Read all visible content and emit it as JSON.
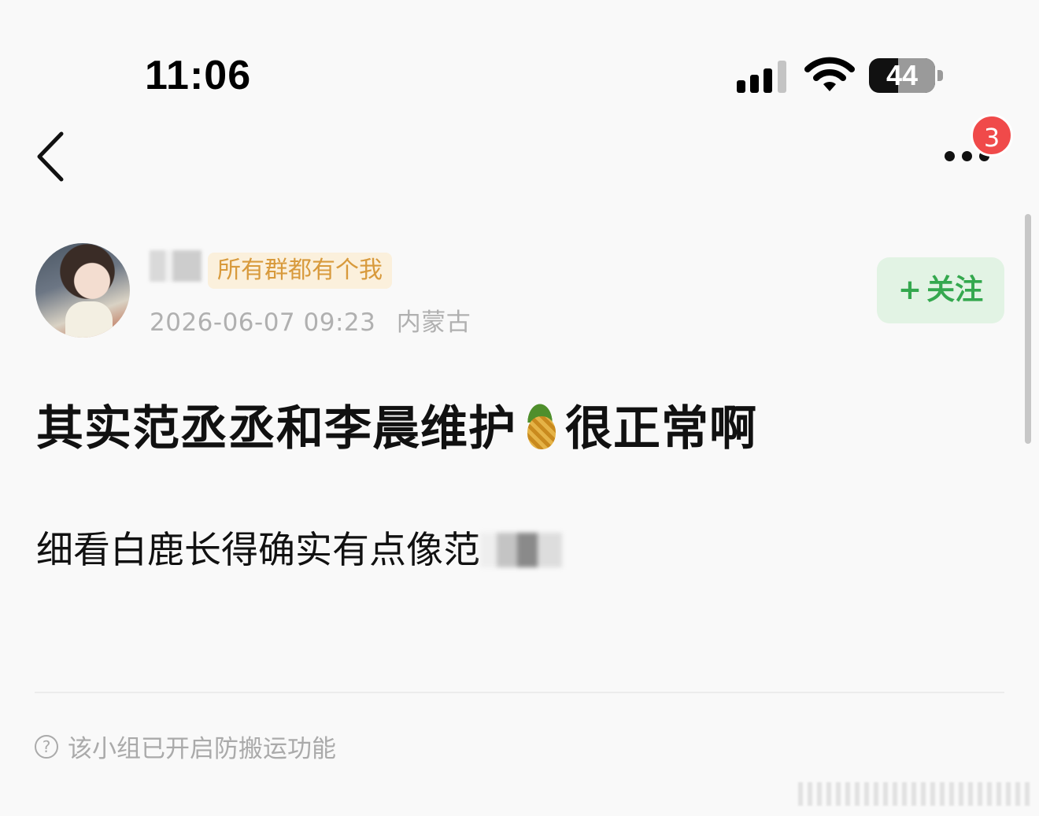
{
  "status_bar": {
    "time": "11:06",
    "battery": "44"
  },
  "nav": {
    "badge_count": "3"
  },
  "post": {
    "group_tag": "所有群都有个我",
    "timestamp": "2026-06-07 09:23",
    "location": "内蒙古",
    "follow_plus": "+",
    "follow_label": "关注",
    "title_before": "其实范丞丞和李晨维护",
    "title_after": "很正常啊",
    "body_text": "细看白鹿长得确实有点像范"
  },
  "footer": {
    "notice": "该小组已开启防搬运功能"
  },
  "icons": {
    "back": "chevron-left-icon",
    "more": "more-dots-icon",
    "emoji": "pineapple-emoji",
    "help": "question-circle-icon"
  },
  "colors": {
    "follow_bg": "#e2f3e4",
    "follow_text": "#34a84e",
    "badge": "#f04a4a",
    "group_tag_bg": "#fbf0dc",
    "group_tag_text": "#d89a3c"
  }
}
